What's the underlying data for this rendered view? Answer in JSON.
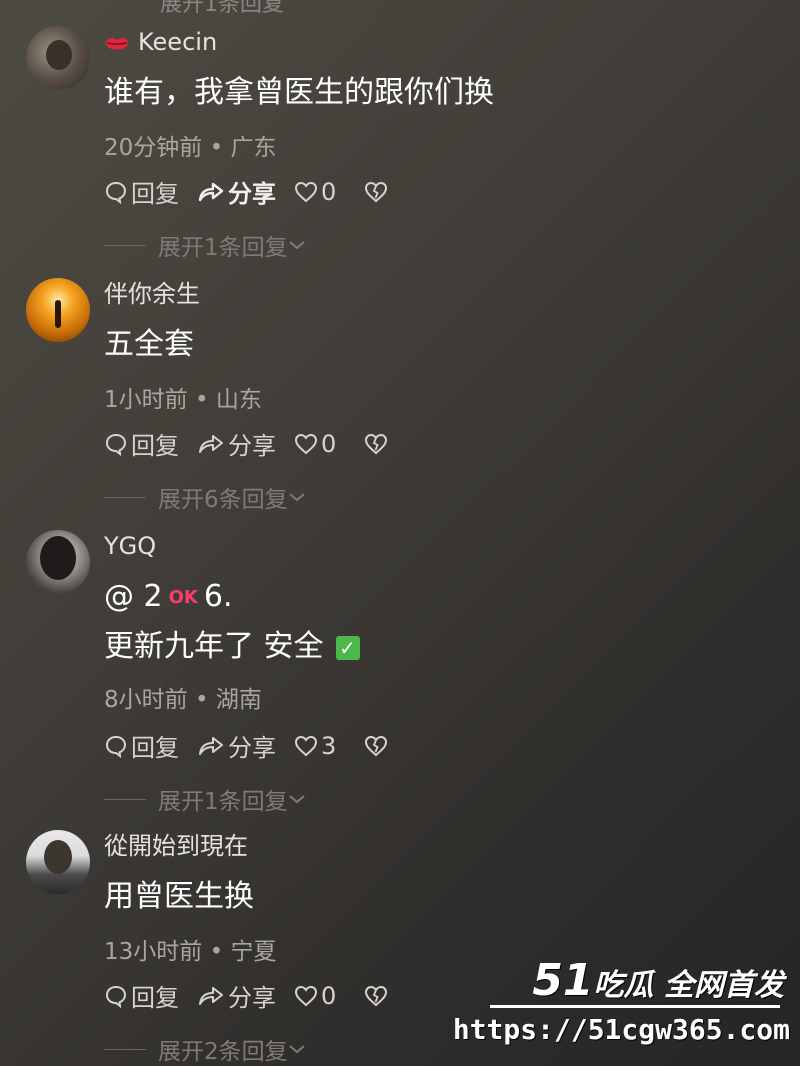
{
  "top_partial": "展开1条回复",
  "comments": [
    {
      "username": "Keecin",
      "has_lips_icon": true,
      "text": "谁有，我拿曾医生的跟你们换",
      "time": "20分钟前",
      "location": "广东",
      "reply_label": "回复",
      "share_label": "分享",
      "likes": "0",
      "expand": "展开1条回复"
    },
    {
      "username": "伴你余生",
      "text": "五全套",
      "time": "1小时前",
      "location": "山东",
      "reply_label": "回复",
      "share_label": "分享",
      "likes": "0",
      "expand": "展开6条回复"
    },
    {
      "username": "YGQ",
      "text_line1_a": "@ 2",
      "text_line1_badge": "OK",
      "text_line1_b": "6.",
      "text_line2": "更新九年了 安全",
      "time": "8小时前",
      "location": "湖南",
      "reply_label": "回复",
      "share_label": "分享",
      "likes": "3",
      "expand": "展开1条回复"
    },
    {
      "username": "從開始到現在",
      "text": "用曾医生换",
      "time": "13小时前",
      "location": "宁夏",
      "reply_label": "回复",
      "share_label": "分享",
      "likes": "0",
      "expand": "展开2条回复"
    }
  ],
  "separator": "•",
  "watermark": {
    "num": "51",
    "title": "吃瓜 全网首发",
    "url": "https://51cgw365.com"
  },
  "colors": {
    "lips": "#e0263a",
    "ok": "#ff3b6b",
    "check": "#4cb84c"
  }
}
